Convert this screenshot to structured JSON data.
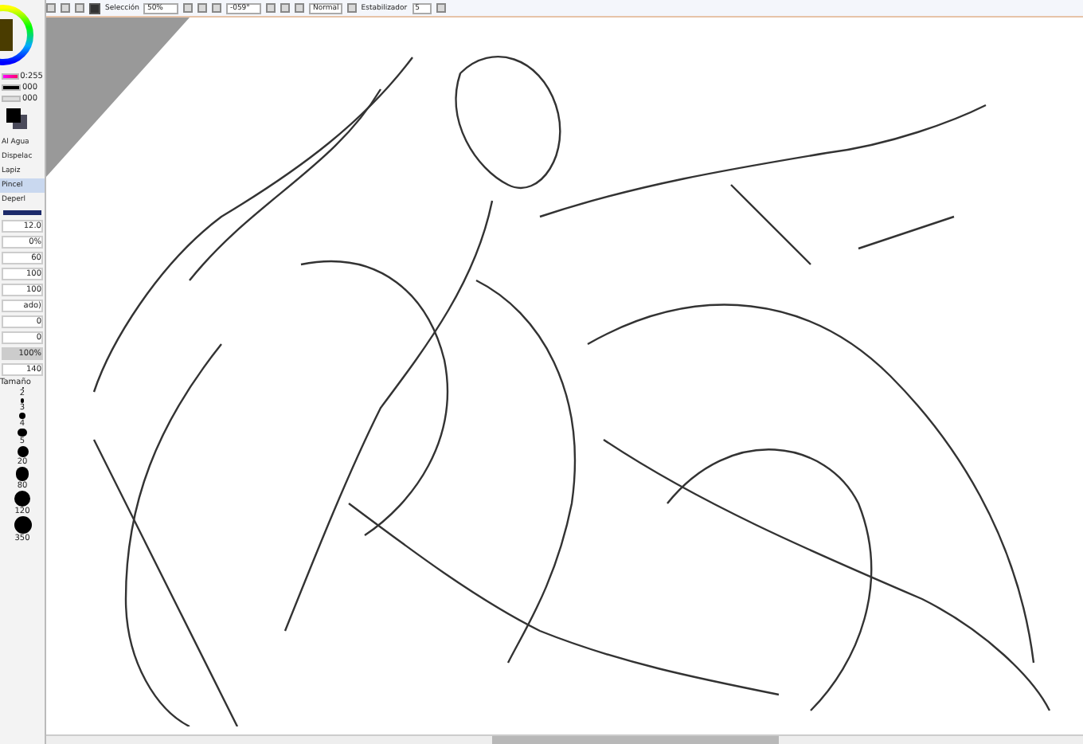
{
  "toolbar": {
    "selection": {
      "label": "Selección",
      "checked": true
    },
    "zoom": "50%",
    "rotation": "-059°",
    "blend_mode": "Normal",
    "stabilizer_label": "Estabilizador",
    "stabilizer_value": "5"
  },
  "color_panel": {
    "slider_reading": "0:255",
    "value_2": "000",
    "value_3": "000",
    "sliders": [
      {
        "level": 1
      },
      {
        "level": 1
      },
      {
        "level": 1
      }
    ]
  },
  "tools": [
    {
      "label": "Al Agua",
      "selected": false
    },
    {
      "label": "Dispelac",
      "selected": false
    },
    {
      "label": "Lapiz",
      "selected": false
    },
    {
      "label": "Pincel",
      "selected": true
    },
    {
      "label": "Deperl",
      "selected": false
    }
  ],
  "settings": [
    "12.0",
    "0%",
    "60",
    "100",
    "100"
  ],
  "settings_2": {
    "mode": "ado)",
    "values": [
      "0",
      "0"
    ],
    "density": "100%",
    "size_value": "140",
    "size_label": "Tamaño"
  },
  "brush_sizes": [
    "2",
    "3",
    "4",
    "5",
    "20",
    "80",
    "120",
    "350"
  ]
}
